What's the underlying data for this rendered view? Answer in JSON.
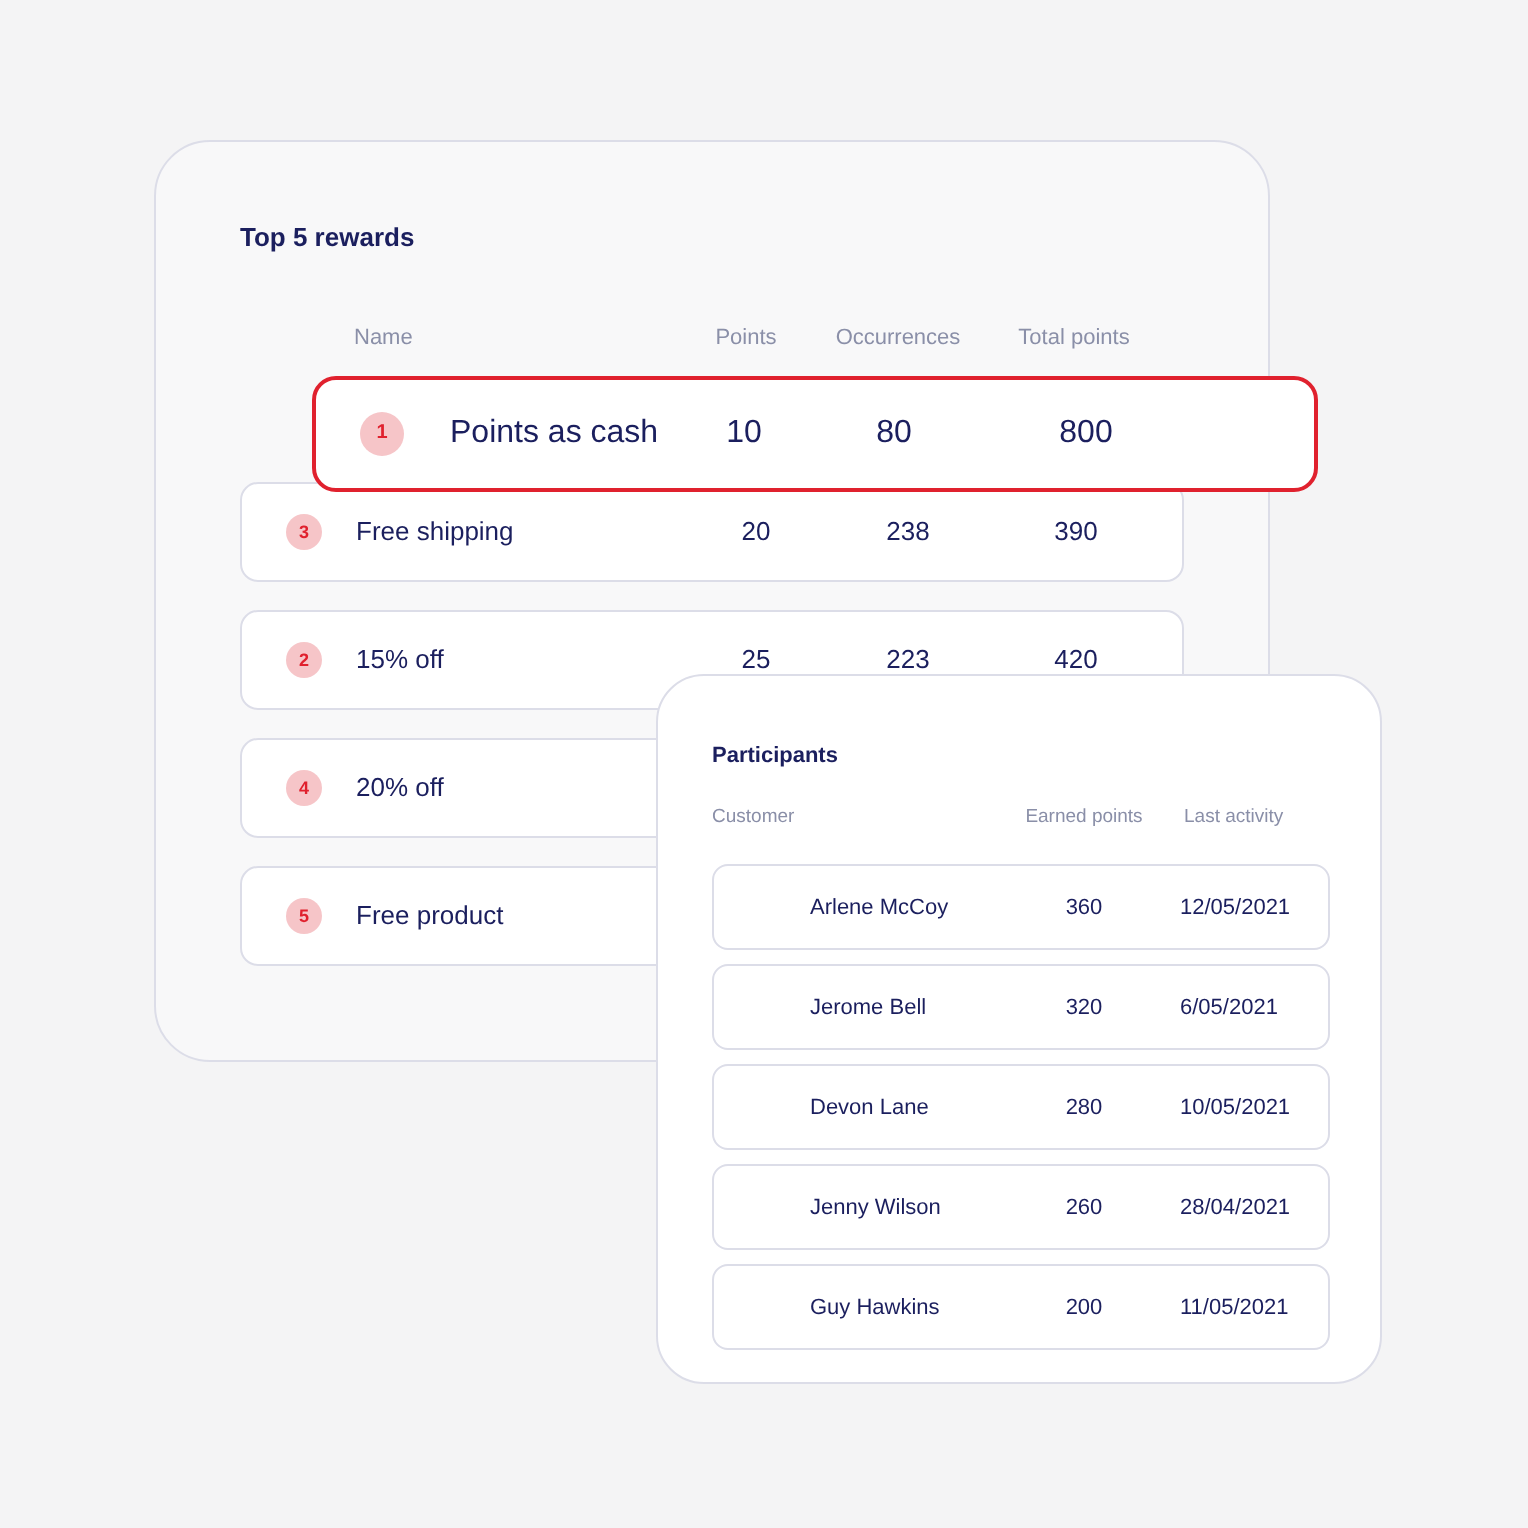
{
  "rewards_card": {
    "title": "Top 5 rewards",
    "columns": [
      "Name",
      "Points",
      "Occurrences",
      "Total points"
    ],
    "top_reward": {
      "rank": "1",
      "name": "Points as cash",
      "points": "10",
      "occurrences": "80",
      "total": "800"
    },
    "rows": [
      {
        "rank": "3",
        "name": "Free shipping",
        "points": "20",
        "occurrences": "238",
        "total": "390"
      },
      {
        "rank": "2",
        "name": "15% off",
        "points": "25",
        "occurrences": "223",
        "total": "420"
      },
      {
        "rank": "4",
        "name": "20% off"
      },
      {
        "rank": "5",
        "name": "Free product"
      }
    ]
  },
  "participants_card": {
    "title": "Participants",
    "columns": [
      "Customer",
      "Earned points",
      "Last activity"
    ],
    "rows": [
      {
        "customer": "Arlene McCoy",
        "earned_points": "360",
        "last_activity": "12/05/2021"
      },
      {
        "customer": "Jerome Bell",
        "earned_points": "320",
        "last_activity": "6/05/2021"
      },
      {
        "customer": "Devon Lane",
        "earned_points": "280",
        "last_activity": "10/05/2021"
      },
      {
        "customer": "Jenny Wilson",
        "earned_points": "260",
        "last_activity": "28/04/2021"
      },
      {
        "customer": "Guy Hawkins",
        "earned_points": "200",
        "last_activity": "11/05/2021"
      }
    ]
  }
}
